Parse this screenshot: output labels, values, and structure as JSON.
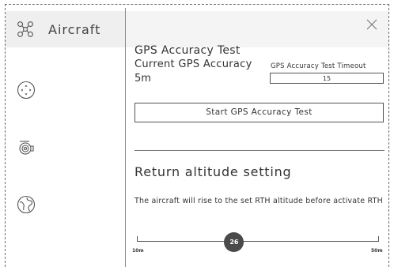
{
  "sidebar": {
    "header_label": "Aircraft",
    "header_icon": "drone-icon",
    "items": [
      {
        "icon": "remote-controller-icon"
      },
      {
        "icon": "camera-icon"
      },
      {
        "icon": "map-icon"
      }
    ]
  },
  "gps": {
    "title": "GPS Accuracy Test",
    "current_label": "Current GPS Accuracy",
    "current_value": "5m",
    "timeout_label": "GPS Accuracy Test Timeout",
    "timeout_value": "15",
    "start_button": "Start  GPS Accuracy Test"
  },
  "rth": {
    "title": "Return altitude setting",
    "description": "The aircraft will rise to the set RTH altitude before activate RTH",
    "slider_min_label": "10m",
    "slider_max_label": "50m",
    "slider_value": "26",
    "slider_min": 10,
    "slider_max": 50
  },
  "colors": {
    "header_bg": "#efefef",
    "thumb": "#4a4a4a"
  }
}
